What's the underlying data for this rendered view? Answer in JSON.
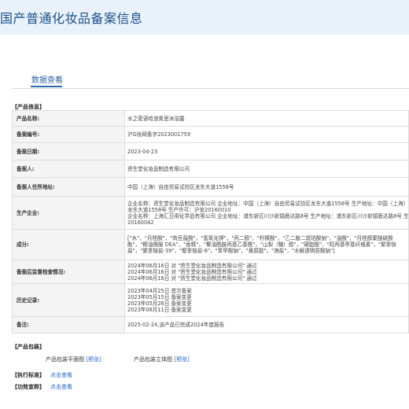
{
  "header": {
    "title": "国产普通化妆品备案信息"
  },
  "tabs": [
    {
      "label": "数据查看"
    }
  ],
  "section_product_info": "【产品信息】",
  "rows": [
    {
      "label": "产品名称:",
      "value": "水之密语哈浪奥思沐浴露"
    },
    {
      "label": "备案编号:",
      "value": "沪G妆网备字2023001759"
    },
    {
      "label": "备案日期:",
      "value": "2023-04-23"
    },
    {
      "label": "备案人:",
      "value": "资生堂化妆品制造有限公司"
    },
    {
      "label": "备案人住所地址:",
      "value": "中国（上海）自由贸易试验区龙东大道1558号"
    },
    {
      "label": "生产企业:",
      "lines": [
        "企业名称：资生堂化妆品制造有限公司 企业地址：中国（上海）自由贸易试验区龙东大道1558号 生产地址：中国（上海）自由贸易试验区",
        "龙东大道1558号 生产许可：沪妆20160010",
        "企业名称：上海汇日用化学品有限公司 企业地址：浦东新区川沙新镇鹿达路8号 生产地址：浦东新区川沙新镇鹿达路8号 生产许可：沪妆",
        "20160042"
      ]
    },
    {
      "label": "成分:",
      "lines": [
        "[\"水\"，\"月桂酸\"，\"肉豆蔻酸\"，\"氢氧化钾\"，\"丙二醇\"，\"柠檬酸\"，\"乙二胺二琥珀酸钠\"，\"油酸\"，\"月桂醇聚醚硫酸",
        "酯\"，\"椰油酰胺 DEA\"，\"香精\"，\"椰油酰胺丙基乙基酰\"，\"山梨（糖）醇\"，\"硬脂酸\"，\"羟丙基甲基纤维素\"，\"聚季铵",
        "盐\"，\"聚季铵盐-39\"，\"聚季铵盐-6\"，\"苯甲酸钠\"，\"黄原胶\"，\"海盐\"，\"水解透明质酸钠\"]"
      ]
    },
    {
      "label": "备案后监督检查情况:",
      "lines": [
        "2024年06月16日 对 \"资生堂化妆品制造有限公司\" 通过",
        "2024年06月16日 对 \"资生堂化妆品制造有限公司\" 通过",
        "2024年06月16日 对 \"资生堂化妆品制造有限公司\" 通过"
      ]
    },
    {
      "label": "历史记录:",
      "lines": [
        "2023年04月25日 首次备案",
        "2023年05月15日 备案变更",
        "2023年05月26日 备案变更",
        "2023年08月11日 备案变更"
      ]
    },
    {
      "label": "备注:",
      "value": "2025-02-24,该产品已完成2024年度报告"
    }
  ],
  "section_packaging": "【产品包装】",
  "packaging": {
    "flat_label": "产品包装平面图",
    "flat_link": "[预览]",
    "solid_label": "产品包装立体图",
    "solid_link": "[预览]"
  },
  "section_standard": "【执行标准】",
  "standard_link": "点击查看",
  "section_efficacy": "【功效宣称】",
  "efficacy_link": "点击查看"
}
